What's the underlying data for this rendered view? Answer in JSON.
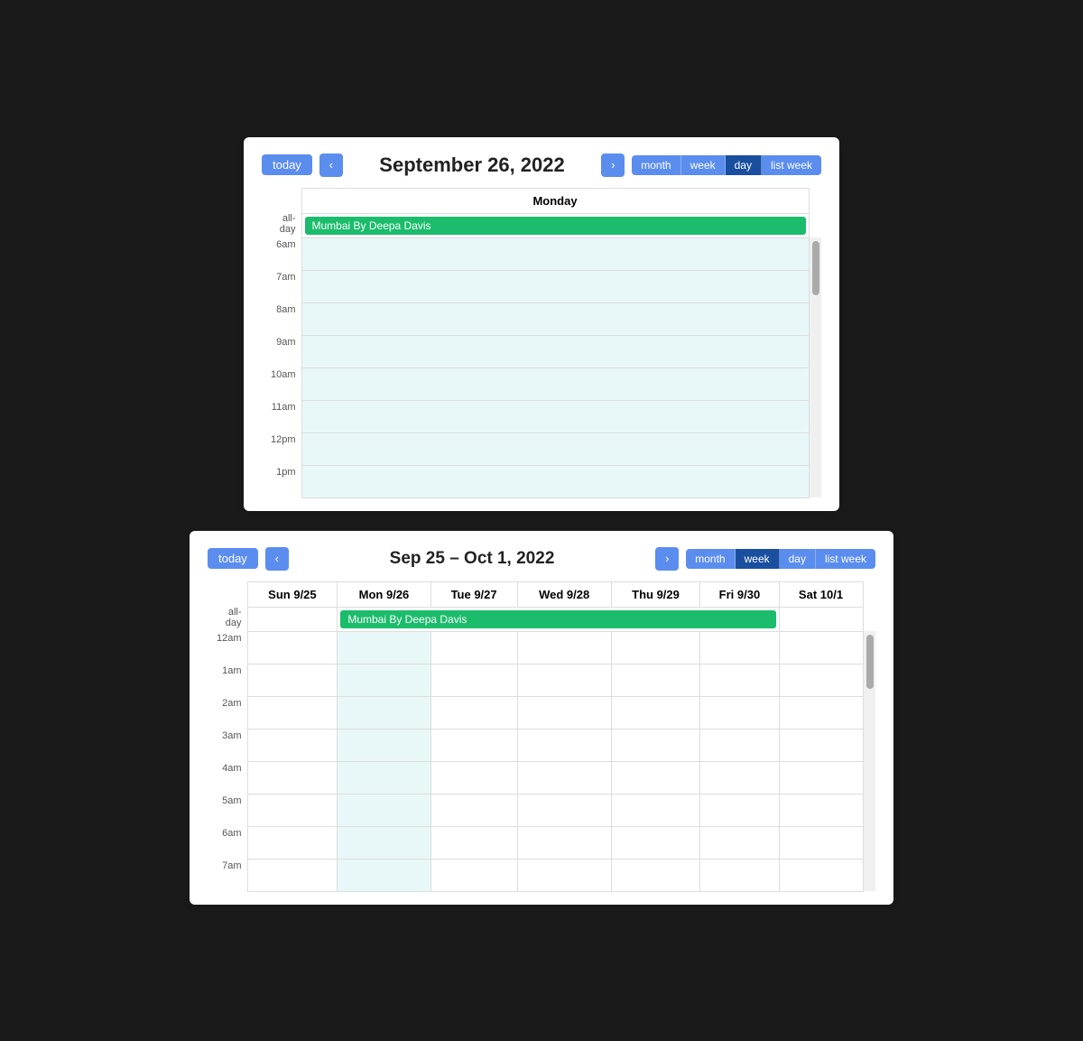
{
  "top": {
    "today_label": "today",
    "prev_label": "‹",
    "next_label": "›",
    "date_title": "September 26, 2022",
    "views": [
      "month",
      "week",
      "day",
      "list week"
    ],
    "active_view": "day",
    "columns": [
      {
        "label": "Monday"
      }
    ],
    "allday_label": "all-day",
    "event": "Mumbai By Deepa Davis",
    "times": [
      "6am",
      "7am",
      "8am",
      "9am",
      "10am",
      "11am",
      "12pm",
      "1pm"
    ]
  },
  "bottom": {
    "today_label": "today",
    "prev_label": "‹",
    "next_label": "›",
    "date_title": "Sep 25 – Oct 1, 2022",
    "views": [
      "month",
      "week",
      "day",
      "list week"
    ],
    "active_view": "week",
    "columns": [
      {
        "label": "Sun 9/25"
      },
      {
        "label": "Mon 9/26"
      },
      {
        "label": "Tue 9/27"
      },
      {
        "label": "Wed 9/28"
      },
      {
        "label": "Thu 9/29"
      },
      {
        "label": "Fri 9/30"
      },
      {
        "label": "Sat 10/1"
      }
    ],
    "allday_label": "all-day",
    "event": "Mumbai By Deepa Davis",
    "event_span": 5,
    "times": [
      "12am",
      "1am",
      "2am",
      "3am",
      "4am",
      "5am",
      "6am",
      "7am"
    ]
  }
}
